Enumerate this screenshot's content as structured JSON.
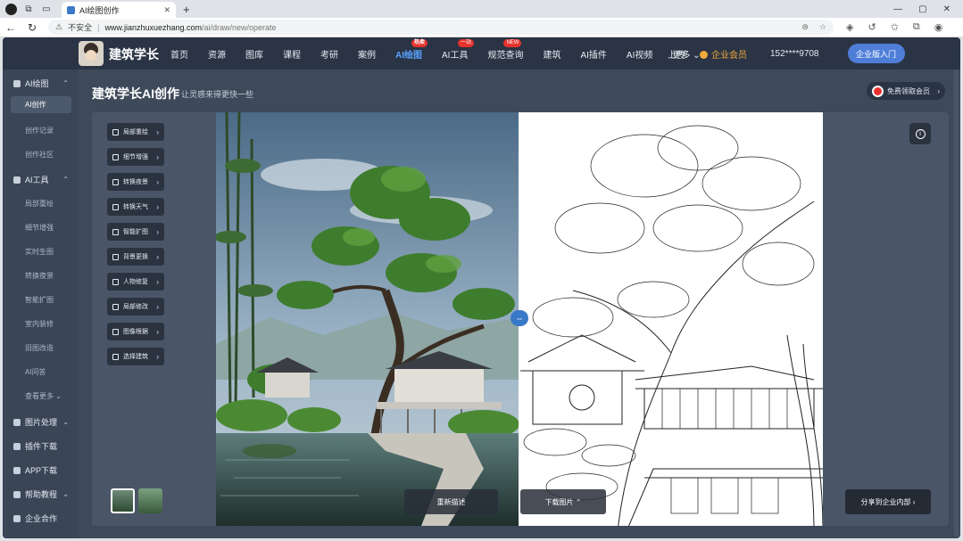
{
  "browser": {
    "tab_title": "AI绘图创作",
    "tab_close": "✕",
    "new_tab": "+",
    "url_warning": "不安全",
    "url_host": "www.jianzhuxuezhang.com",
    "url_path": "/ai/draw/new/operate",
    "win_min": "—",
    "win_max": "▢",
    "win_close": "✕"
  },
  "topnav": {
    "logo": "建筑学长",
    "items": [
      {
        "label": "首页"
      },
      {
        "label": "资源"
      },
      {
        "label": "图库"
      },
      {
        "label": "课程"
      },
      {
        "label": "考研"
      },
      {
        "label": "案例"
      },
      {
        "label": "AI绘图",
        "badge": "热卖",
        "active": true
      },
      {
        "label": "AI工具",
        "badge": "一站"
      },
      {
        "label": "规范查询",
        "badge": "NEW"
      },
      {
        "label": "建筑"
      },
      {
        "label": "AI插件"
      },
      {
        "label": "AI视频"
      },
      {
        "label": "更多 ⌄"
      }
    ],
    "upload": "上传",
    "vip": "企业会员",
    "phone": "152****9708",
    "enterprise_btn": "企业版入门"
  },
  "sidebar": {
    "sec_ai_draw": "AI绘图",
    "items_ai_draw": [
      "AI创作",
      "创作记录",
      "创作社区"
    ],
    "sec_ai_tools": "AI工具",
    "items_ai_tools": [
      "局部重绘",
      "细节增强",
      "实时生图",
      "转换夜景",
      "智能扩图",
      "室内装修",
      "旧图改造",
      "AI问答",
      "查看更多 ⌄"
    ],
    "sec_image_process": "图片处理",
    "sec_plugins": "插件下载",
    "sec_app": "APP下载",
    "sec_help": "帮助教程",
    "sec_enterprise": "企业合作"
  },
  "main": {
    "title": "建筑学长AI创作",
    "subtitle": "让灵感来得更快一些",
    "promo": "免费领取会员"
  },
  "tools": [
    {
      "label": "局部重绘"
    },
    {
      "label": "细节增强"
    },
    {
      "label": "转换夜景"
    },
    {
      "label": "转换天气"
    },
    {
      "label": "智能扩图"
    },
    {
      "label": "背景更换"
    },
    {
      "label": "人物修复"
    },
    {
      "label": "局部修改"
    },
    {
      "label": "图像根据"
    },
    {
      "label": "选择建筑"
    }
  ],
  "actions": {
    "reset": "重新描述",
    "download": "下载图片 ⌃",
    "share": "分享到企业内部 ›"
  },
  "colors": {
    "accent": "#3a78c8",
    "nav_bg": "#2a3444",
    "app_bg": "#3e4a5a",
    "badge": "#e5322d",
    "vip": "#f0a93d"
  }
}
